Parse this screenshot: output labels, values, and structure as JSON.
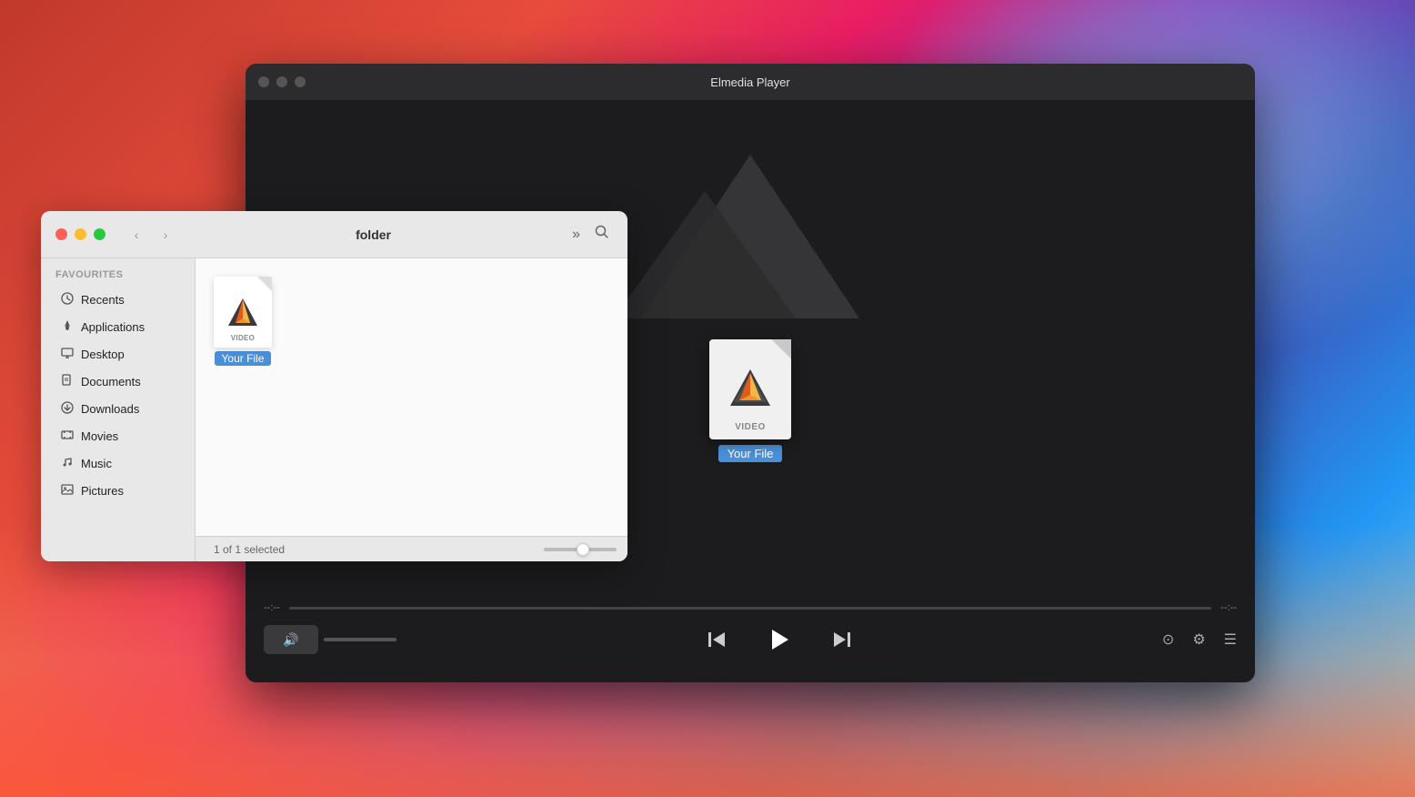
{
  "desktop": {
    "background": "macOS desktop with colorful gradient"
  },
  "player_window": {
    "title": "Elmedia Player",
    "traffic_lights": {
      "close": "●",
      "minimize": "●",
      "maximize": "●"
    },
    "file_icon": {
      "label": "VIDEO",
      "name": "Your File"
    },
    "controls": {
      "time_start": "--:--",
      "time_end": "--:--",
      "play_button": "▶",
      "prev_button": "⏮",
      "next_button": "⏭",
      "volume_icon": "🔊",
      "airplay_icon": "⊙",
      "settings_icon": "⚙",
      "playlist_icon": "☰"
    }
  },
  "finder_window": {
    "title": "folder",
    "traffic_lights": {
      "close": "●",
      "minimize": "●",
      "maximize": "●"
    },
    "nav": {
      "back": "‹",
      "forward": "›",
      "more": "»",
      "search": "⌕"
    },
    "sidebar": {
      "section_label": "Favourites",
      "items": [
        {
          "id": "recents",
          "icon": "🕐",
          "label": "Recents"
        },
        {
          "id": "applications",
          "icon": "🚀",
          "label": "Applications"
        },
        {
          "id": "desktop",
          "icon": "🖥",
          "label": "Desktop"
        },
        {
          "id": "documents",
          "icon": "📄",
          "label": "Documents"
        },
        {
          "id": "downloads",
          "icon": "⬇",
          "label": "Downloads"
        },
        {
          "id": "movies",
          "icon": "📽",
          "label": "Movies"
        },
        {
          "id": "music",
          "icon": "🎵",
          "label": "Music"
        },
        {
          "id": "pictures",
          "icon": "🖼",
          "label": "Pictures"
        }
      ]
    },
    "file": {
      "type_label": "VIDEO",
      "name": "Your File"
    },
    "statusbar": {
      "selection_text": "1 of 1 selected"
    }
  }
}
